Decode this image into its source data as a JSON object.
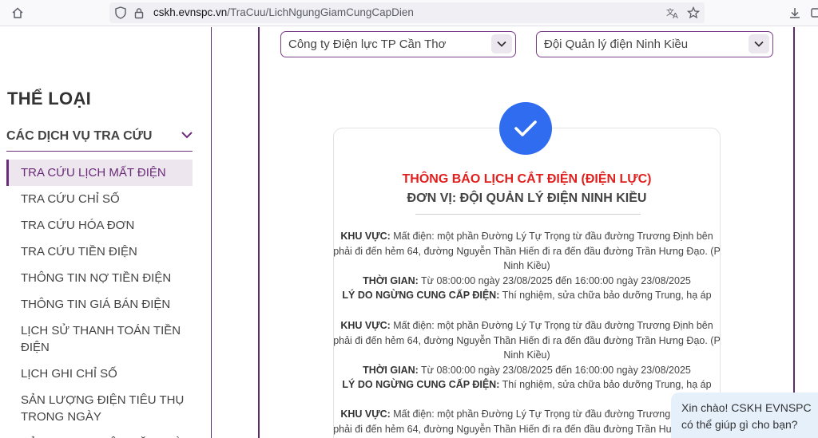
{
  "browser": {
    "url_domain": "cskh.evnspc.vn",
    "url_path": "/TraCuu/LichNgungGiamCungCapDien"
  },
  "sidebar": {
    "title": "THỂ LOẠI",
    "group_label": "CÁC DỊCH VỤ TRA CỨU",
    "items": [
      {
        "label": "TRA CỨU LỊCH MẤT ĐIỆN",
        "active": true
      },
      {
        "label": "TRA CỨU CHỈ SỐ"
      },
      {
        "label": "TRA CỨU HÓA ĐƠN"
      },
      {
        "label": "TRA CỨU TIỀN ĐIỆN"
      },
      {
        "label": "THÔNG TIN NỢ TIỀN ĐIỆN"
      },
      {
        "label": "THÔNG TIN GIÁ BÁN ĐIỆN"
      },
      {
        "label": "LỊCH SỬ THANH TOÁN TIỀN ĐIỆN"
      },
      {
        "label": "LỊCH GHI CHỈ SỐ"
      },
      {
        "label": "SẢN LƯỢNG ĐIỆN TIÊU THỤ TRONG NGÀY"
      },
      {
        "label": "SẢN LƯỢNG ĐIỆN MẶT TRỜI"
      }
    ]
  },
  "filters": {
    "company": "Công ty Điện lực TP Cần Thơ",
    "unit": "Đội Quản lý điện Ninh Kiều"
  },
  "notice": {
    "title": "THÔNG BÁO LỊCH CẮT ĐIỆN (ĐIỆN LỰC)",
    "unit_line": "ĐƠN VỊ: ĐỘI QUẢN LÝ ĐIỆN NINH KIỀU",
    "labels": {
      "area": "KHU VỰC:",
      "time": "THỜI GIAN:",
      "reason": "LÝ DO NGỪNG CUNG CẤP ĐIỆN:"
    },
    "entries": [
      {
        "area": "Mất điện: một phần Đường Lý Tự Trọng từ đầu đường Trương Định bên phải đi đến hẻm 64, đường Nguyễn Thần Hiến đi ra đến đầu đường Trần Hưng Đạo. (P Ninh Kiều)",
        "time": "Từ 08:00:00 ngày 23/08/2025 đến 16:00:00 ngày 23/08/2025",
        "reason": "Thí nghiệm, sửa chữa bảo dưỡng Trung, hạ áp"
      },
      {
        "area": "Mất điện: một phần Đường Lý Tự Trọng từ đầu đường Trương Định bên phải đi đến hẻm 64, đường Nguyễn Thần Hiến đi ra đến đầu đường Trần Hưng Đạo. (P Ninh Kiều)",
        "time": "Từ 08:00:00 ngày 23/08/2025 đến 16:00:00 ngày 23/08/2025",
        "reason": "Thí nghiệm, sửa chữa bảo dưỡng Trung, hạ áp"
      },
      {
        "area": "Mất điện: một phần Đường Lý Tự Trọng từ đầu đường Trương Định bên phải đi đến hẻm 64, đường Nguyễn Thần Hiến đi ra đến đầu đường Trần Hưng Đạo. (P Ninh Kiều)"
      }
    ]
  },
  "chat": {
    "line1": "Xin chào! CSKH EVNSPC",
    "line2": "có thể giúp gì cho bạn?"
  },
  "colors": {
    "brand_purple": "#6a2c78",
    "notice_red": "#e0201f",
    "check_blue": "#2f6cf0"
  }
}
